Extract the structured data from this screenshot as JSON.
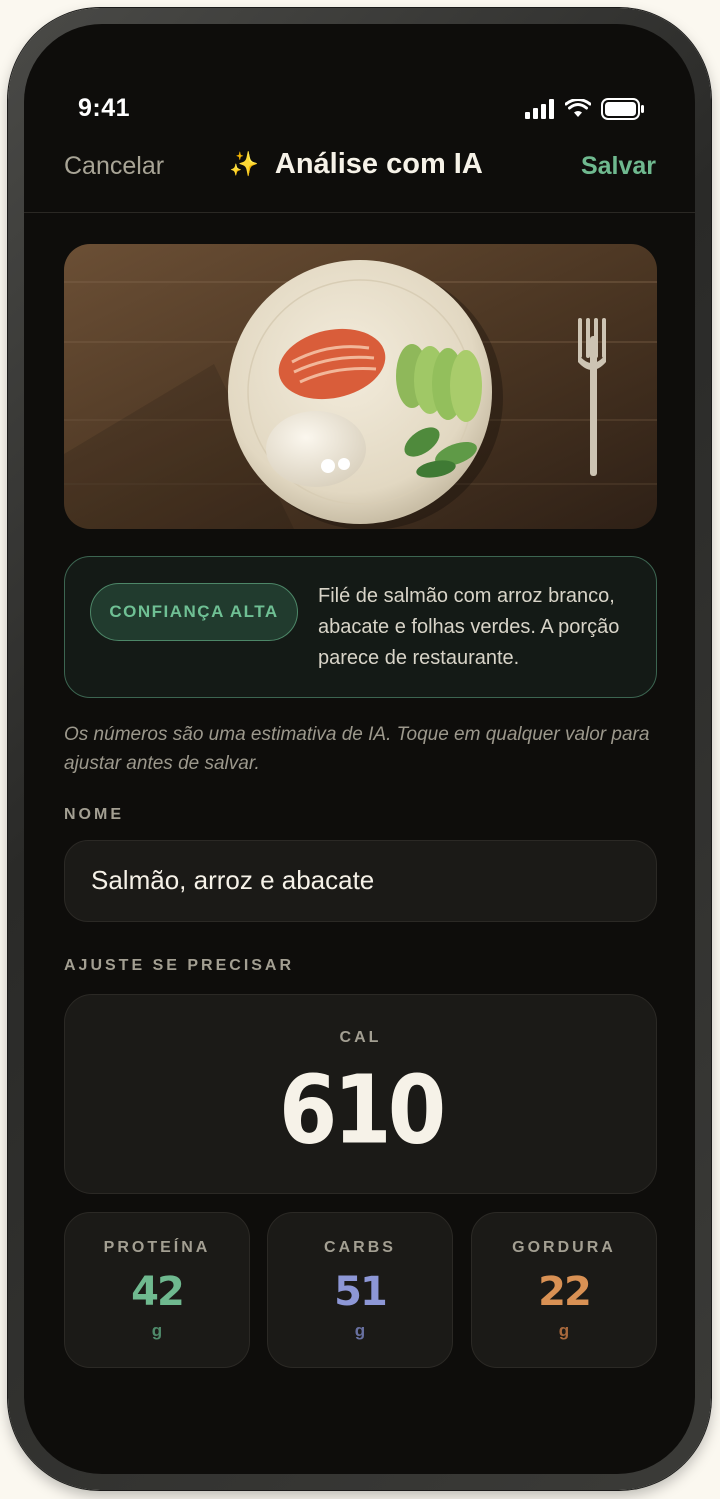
{
  "status_bar": {
    "time": "9:41"
  },
  "nav": {
    "cancel_label": "Cancelar",
    "title": "Análise com IA",
    "save_label": "Salvar",
    "title_icon": "sparkles-icon"
  },
  "analysis": {
    "confidence_label": "CONFIANÇA ALTA",
    "description": "Filé de salmão com arroz branco, abacate e folhas verdes. A porção parece de restaurante."
  },
  "disclaimer": "Os números são uma estimativa de IA. Toque em qualquer valor para ajustar antes de salvar.",
  "name_section": {
    "label": "NOME",
    "value": "Salmão, arroz e abacate"
  },
  "adjust_section": {
    "label": "AJUSTE SE PRECISAR"
  },
  "calories": {
    "label": "CAL",
    "value": "610"
  },
  "macros": [
    {
      "label": "PROTEÍNA",
      "value": "42",
      "unit": "g",
      "color": "#6fb98f"
    },
    {
      "label": "CARBS",
      "value": "51",
      "unit": "g",
      "color": "#8d97d6"
    },
    {
      "label": "GORDURA",
      "value": "22",
      "unit": "g",
      "color": "#d99154"
    }
  ],
  "colors": {
    "accent_green": "#6fb98f",
    "background": "#0e0d0b",
    "card": "#1b1a17"
  }
}
